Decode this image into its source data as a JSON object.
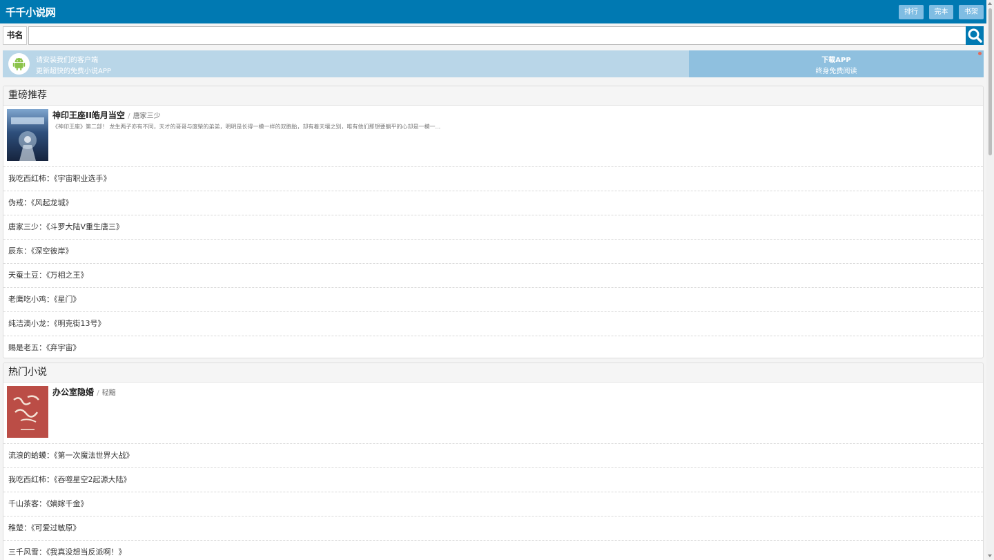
{
  "header": {
    "logo": "千千小说网",
    "buttons": [
      "排行",
      "完本",
      "书架"
    ]
  },
  "search": {
    "label": "书名",
    "placeholder": "",
    "icon": "search-icon"
  },
  "banner": {
    "line1": "请安装我们的客户端",
    "line2": "更新超快的免费小说APP",
    "download_title": "下载APP",
    "download_sub": "终身免费阅读",
    "icon": "android-icon"
  },
  "sections": [
    {
      "title": "重磅推荐",
      "featured": {
        "title": "神印王座II皓月当空",
        "sep": "/",
        "author": "唐家三少",
        "desc": "《神印王座》第二部！ 龙生两子亦有不同，天才的哥哥与废柴的弟弟，明明是长得一模一样的双胞胎，却有着天壤之别，唯有他们那想要躺平的心却是一模一..."
      },
      "items": [
        "我吃西红柿：《宇宙职业选手》",
        "伪戒：《风起龙城》",
        "唐家三少：《斗罗大陆V重生唐三》",
        "辰东：《深空彼岸》",
        "天蚕土豆：《万相之王》",
        "老鹰吃小鸡：《星门》",
        "纯洁滴小龙：《明克街13号》",
        "赐是老五：《弃宇宙》"
      ]
    },
    {
      "title": "热门小说",
      "featured": {
        "title": "办公室隐婚",
        "sep": "/",
        "author": "轻黯",
        "desc": ""
      },
      "items": [
        "流浪的蛤蟆：《第一次魔法世界大战》",
        "我吃西红柿：《吞噬星空2起源大陆》",
        "千山茶客：《嫡嫁千金》",
        "稚楚：《可爱过敏原》",
        "三千风雪：《我真没想当反派啊！》"
      ]
    }
  ],
  "colors": {
    "primary": "#0079b2",
    "header_button": "#7fbde3",
    "banner_left": "#b9d6e8",
    "banner_right": "#8fc0df"
  }
}
